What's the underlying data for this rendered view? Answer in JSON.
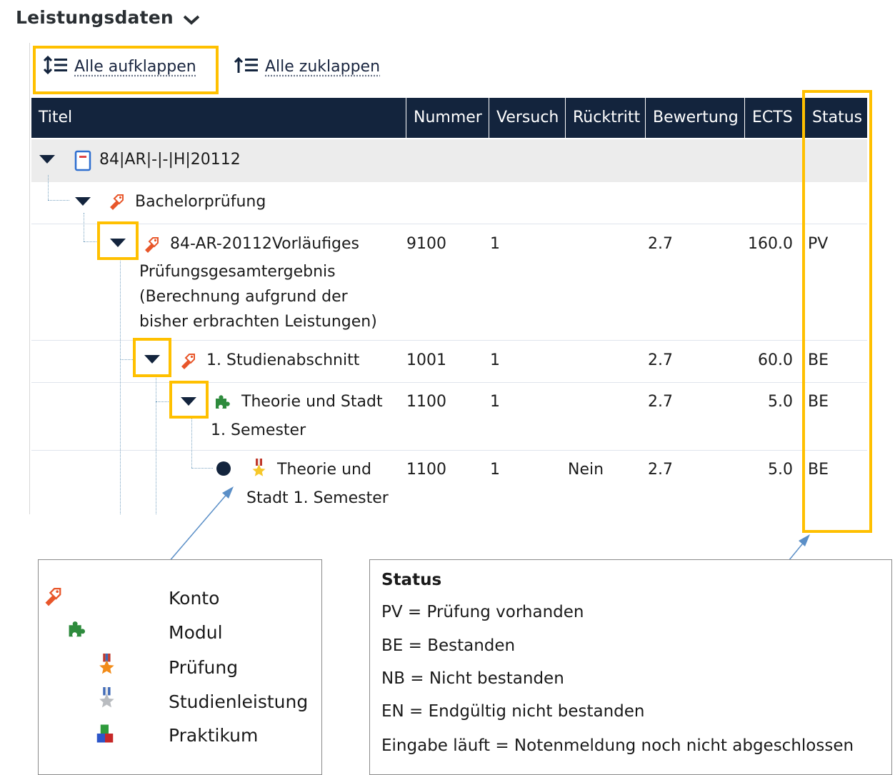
{
  "section": {
    "title": "Leistungsdaten"
  },
  "toolbar": {
    "expand_all": "Alle aufklappen",
    "collapse_all": "Alle zuklappen"
  },
  "table": {
    "columns": [
      "Titel",
      "Nummer",
      "Versuch",
      "Rücktritt",
      "Bewertung",
      "ECTS",
      "Status"
    ],
    "rows": [
      {
        "title": "84|AR|-|-|H|20112",
        "icon": "document-icon"
      },
      {
        "title": "Bachelorprüfung",
        "icon": "tag-icon"
      },
      {
        "title_lines": [
          "84-AR-20112Vorläufiges",
          "Prüfungsgesamtergebnis",
          "(Berechnung aufgrund der",
          "bisher erbrachten Leistungen)"
        ],
        "icon": "tag-icon",
        "nummer": "9100",
        "versuch": "1",
        "ruecktritt": "",
        "bewertung": "2.7",
        "ects": "160.0",
        "status": "PV"
      },
      {
        "title": "1. Studienabschnitt",
        "icon": "tag-icon",
        "nummer": "1001",
        "versuch": "1",
        "ruecktritt": "",
        "bewertung": "2.7",
        "ects": "60.0",
        "status": "BE"
      },
      {
        "title_lines": [
          "Theorie und Stadt",
          "1. Semester"
        ],
        "icon": "puzzle-icon",
        "nummer": "1100",
        "versuch": "1",
        "ruecktritt": "",
        "bewertung": "2.7",
        "ects": "5.0",
        "status": "BE"
      },
      {
        "title_lines": [
          "Theorie und",
          "Stadt 1. Semester"
        ],
        "icon": "medal-icon",
        "nummer": "1100",
        "versuch": "1",
        "ruecktritt": "Nein",
        "bewertung": "2.7",
        "ects": "5.0",
        "status": "BE"
      }
    ]
  },
  "legend": {
    "items": [
      {
        "label": "Konto",
        "icon": "tag-icon"
      },
      {
        "label": "Modul",
        "icon": "puzzle-icon"
      },
      {
        "label": "Prüfung",
        "icon": "medal-orange-icon"
      },
      {
        "label": "Studienleistung",
        "icon": "medal-gray-icon"
      },
      {
        "label": "Praktikum",
        "icon": "blocks-icon"
      }
    ]
  },
  "status_legend": {
    "title": "Status",
    "lines": [
      "PV = Prüfung vorhanden",
      "BE = Bestanden",
      "NB = Nicht bestanden",
      "EN = Endgültig nicht bestanden",
      "Eingabe läuft = Notenmeldung noch nicht abgeschlossen"
    ]
  },
  "colors": {
    "header_bg": "#13243d",
    "highlight": "#ffc000",
    "group_row_bg": "#ececec",
    "arrow": "#5b8fc7"
  }
}
